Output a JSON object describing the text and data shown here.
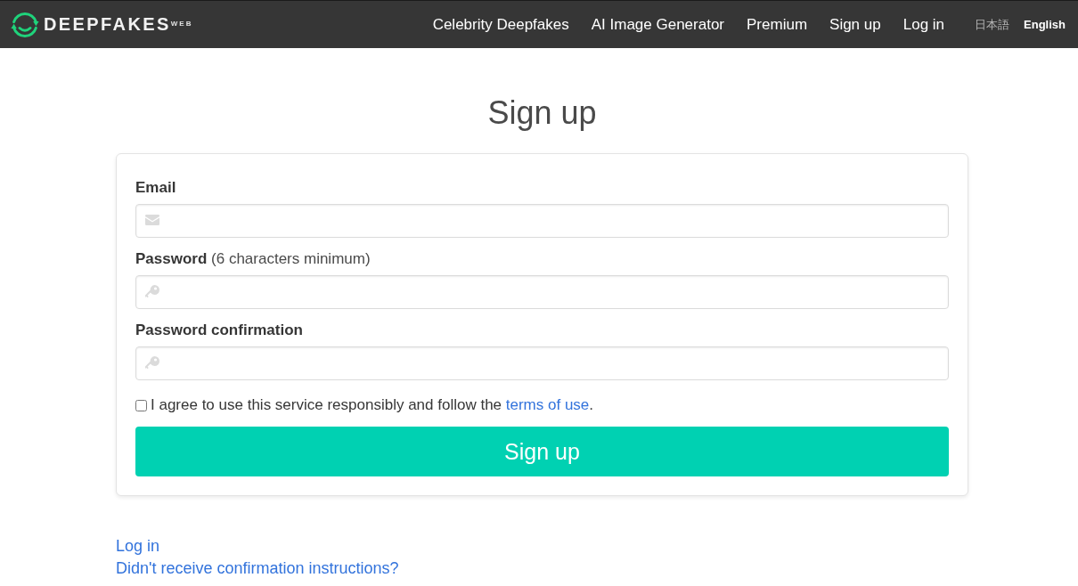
{
  "navbar": {
    "logo": {
      "name": "DEEPFAKES",
      "suffix": "WEB"
    },
    "links": [
      "Celebrity Deepfakes",
      "AI Image Generator",
      "Premium",
      "Sign up",
      "Log in"
    ],
    "languages": [
      {
        "label": "日本語",
        "selected": false
      },
      {
        "label": "English",
        "selected": true
      }
    ]
  },
  "heading": "Sign up",
  "form": {
    "fields": [
      {
        "kind": "email",
        "label": "Email"
      },
      {
        "kind": "password",
        "label": "Password",
        "note": "(6 characters minimum)"
      },
      {
        "kind": "password",
        "label": "Password confirmation"
      }
    ],
    "agreement": {
      "checked": false,
      "text_before": "I agree to use this service responsibly and follow the ",
      "link": "terms of use",
      "text_after": "."
    },
    "submit": "Sign up"
  },
  "footer_links": [
    "Log in",
    "Didn't receive confirmation instructions?"
  ]
}
